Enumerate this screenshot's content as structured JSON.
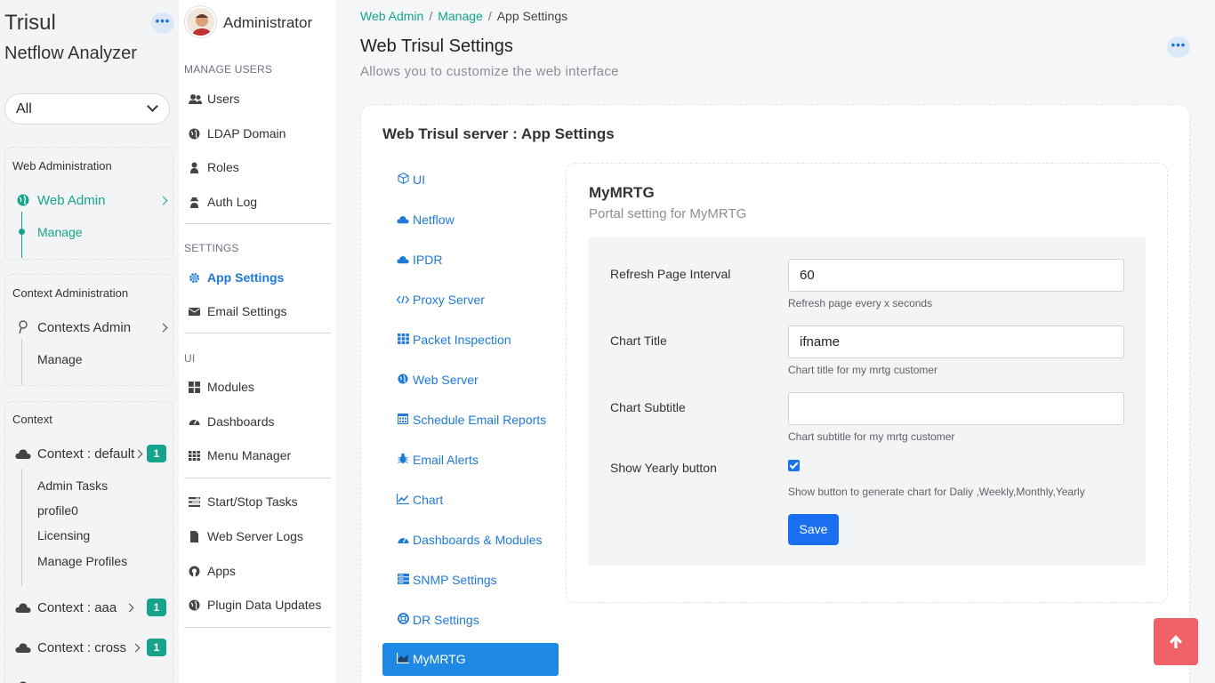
{
  "brand": {
    "title": "Trisul",
    "subtitle": "Netflow Analyzer"
  },
  "context_select": {
    "value": "All"
  },
  "sidebar": {
    "web_admin_box": {
      "title": "Web Administration",
      "main": "Web Admin",
      "sub": "Manage"
    },
    "context_admin_box": {
      "title": "Context Administration",
      "main": "Contexts Admin",
      "sub": "Manage"
    },
    "context_box": {
      "title": "Context",
      "default_label": "Context : default",
      "default_badge": "1",
      "default_items": [
        "Admin Tasks",
        "profile0",
        "Licensing",
        "Manage Profiles"
      ],
      "aaa_label": "Context : aaa",
      "aaa_badge": "1",
      "cross_label": "Context : cross",
      "cross_badge": "1"
    }
  },
  "menu": {
    "user": "Administrator",
    "sections": {
      "manage_users": "MANAGE USERS",
      "settings": "SETTINGS",
      "ui": "UI"
    },
    "manage_users": [
      "Users",
      "LDAP Domain",
      "Roles",
      "Auth Log"
    ],
    "settings": [
      "App Settings",
      "Email Settings"
    ],
    "ui": [
      "Modules",
      "Dashboards",
      "Menu Manager"
    ],
    "tools": [
      "Start/Stop Tasks",
      "Web Server Logs",
      "Apps",
      "Plugin Data Updates"
    ]
  },
  "breadcrumb": {
    "root": "Web Admin",
    "sep": "/",
    "mid": "Manage",
    "current": "App Settings"
  },
  "page": {
    "title": "Web Trisul Settings",
    "subtitle": "Allows you to customize the web interface"
  },
  "card": {
    "title": "Web Trisul server : App Settings"
  },
  "tabs": [
    {
      "label": "UI",
      "icon": "cube-icon"
    },
    {
      "label": "Netflow",
      "icon": "cloud-icon"
    },
    {
      "label": "IPDR",
      "icon": "cloud-icon"
    },
    {
      "label": "Proxy Server",
      "icon": "code-icon"
    },
    {
      "label": "Packet Inspection",
      "icon": "grid-icon"
    },
    {
      "label": "Web Server",
      "icon": "globe-icon"
    },
    {
      "label": "Schedule Email Reports",
      "icon": "calendar-icon"
    },
    {
      "label": "Email Alerts",
      "icon": "bug-icon"
    },
    {
      "label": "Chart",
      "icon": "line-chart-icon"
    },
    {
      "label": "Dashboards & Modules",
      "icon": "dashboard-icon"
    },
    {
      "label": "SNMP Settings",
      "icon": "server-icon"
    },
    {
      "label": "DR Settings",
      "icon": "life-ring-icon"
    },
    {
      "label": "MyMRTG",
      "icon": "area-chart-icon"
    }
  ],
  "panel": {
    "title": "MyMRTG",
    "subtitle": "Portal setting for MyMRTG",
    "fields": {
      "refresh": {
        "label": "Refresh Page Interval",
        "value": "60",
        "hint": "Refresh page every x seconds"
      },
      "chart_title": {
        "label": "Chart Title",
        "value": "ifname",
        "hint": "Chart title for my mrtg customer"
      },
      "chart_subtitle": {
        "label": "Chart Subtitle",
        "value": "",
        "hint": "Chart subtitle for my mrtg customer"
      },
      "yearly": {
        "label": "Show Yearly button",
        "checked": true,
        "hint": "Show button to generate chart for Daliy ,Weekly,Monthly,Yearly"
      }
    },
    "save_label": "Save"
  },
  "colors": {
    "accent_teal": "#15a48b",
    "link_blue": "#1e7ad6",
    "active_tab": "#1e88e5",
    "save": "#1a6ff0",
    "to_top": "#f0616a"
  }
}
